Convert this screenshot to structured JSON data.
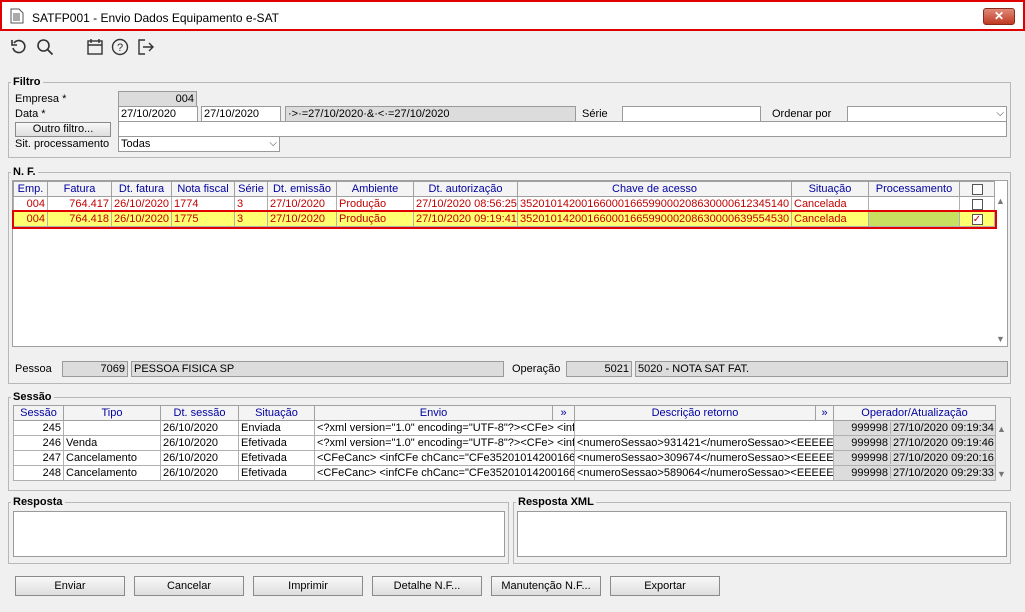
{
  "window": {
    "title": "SATFP001 - Envio Dados Equipamento e-SAT",
    "close": "✕"
  },
  "toolbar": {
    "icons": [
      "refresh-icon",
      "search-icon",
      "calendar-icon",
      "help-icon",
      "exit-icon"
    ]
  },
  "filtro": {
    "legend": "Filtro",
    "empresa_label": "Empresa *",
    "empresa_value": "004",
    "data_label": "Data *",
    "data_from": "27/10/2020",
    "data_to": "27/10/2020",
    "data_expr": "·>·=27/10/2020·&·<·=27/10/2020",
    "serie_label": "Série",
    "serie_value": "",
    "ordenar_label": "Ordenar por",
    "ordenar_value": "",
    "outro_filtro": "Outro filtro...",
    "outro_value": "",
    "sit_label": "Sit. processamento",
    "sit_value": "Todas"
  },
  "nf": {
    "legend": "N. F.",
    "columns": [
      "Emp.",
      "Fatura",
      "Dt. fatura",
      "Nota fiscal",
      "Série",
      "Dt. emissão",
      "Ambiente",
      "Dt. autorização",
      "Chave de acesso",
      "Situação",
      "Processamento"
    ],
    "rows": [
      {
        "emp": "004",
        "fatura": "764.417",
        "dt_fatura": "26/10/2020",
        "nota": "1774",
        "serie": "3",
        "dt_emissao": "27/10/2020",
        "ambiente": "Produção",
        "dt_aut": "27/10/2020 08:56:25",
        "chave": "35201014200166000166599000208630000612345140",
        "situacao": "Cancelada",
        "proc": "",
        "checked": false
      },
      {
        "emp": "004",
        "fatura": "764.418",
        "dt_fatura": "26/10/2020",
        "nota": "1775",
        "serie": "3",
        "dt_emissao": "27/10/2020",
        "ambiente": "Produção",
        "dt_aut": "27/10/2020 09:19:41",
        "chave": "35201014200166000166599000208630000639554530",
        "situacao": "Cancelada",
        "proc": "",
        "checked": true
      }
    ],
    "pessoa_label": "Pessoa",
    "pessoa_code": "7069",
    "pessoa_name": "PESSOA FISICA SP",
    "operacao_label": "Operação",
    "operacao_code": "5021",
    "operacao_name": "5020 - NOTA SAT FAT."
  },
  "sessao": {
    "legend": "Sessão",
    "columns": [
      "Sessão",
      "Tipo",
      "Dt. sessão",
      "Situação",
      "Envio",
      "»",
      "Descrição retorno",
      "»",
      "Operador/Atualização"
    ],
    "rows": [
      {
        "sessao": "245",
        "tipo": "",
        "dt": "26/10/2020",
        "sit": "Enviada",
        "envio": "<?xml version=\"1.0\" encoding=\"UTF-8\"?><CFe> <infC",
        "desc": "",
        "op": "999998",
        "atual": "27/10/2020 09:19:34"
      },
      {
        "sessao": "246",
        "tipo": "Venda",
        "dt": "26/10/2020",
        "sit": "Efetivada",
        "envio": "<?xml version=\"1.0\" encoding=\"UTF-8\"?><CFe> <infC",
        "desc": "<numeroSessao>931421</numeroSessao><EEEEE>0",
        "op": "999998",
        "atual": "27/10/2020 09:19:46"
      },
      {
        "sessao": "247",
        "tipo": "Cancelamento",
        "dt": "26/10/2020",
        "sit": "Efetivada",
        "envio": "<CFeCanc> <infCFe chCanc=\"CFe352010142001660",
        "desc": "<numeroSessao>309674</numeroSessao><EEEEE>0",
        "op": "999998",
        "atual": "27/10/2020 09:20:16"
      },
      {
        "sessao": "248",
        "tipo": "Cancelamento",
        "dt": "26/10/2020",
        "sit": "Efetivada",
        "envio": "<CFeCanc> <infCFe chCanc=\"CFe352010142001660",
        "desc": "<numeroSessao>589064</numeroSessao><EEEEE>0",
        "op": "999998",
        "atual": "27/10/2020 09:29:33"
      }
    ]
  },
  "resposta": {
    "legend": "Resposta",
    "value": ""
  },
  "resposta_xml": {
    "legend": "Resposta XML",
    "value": ""
  },
  "buttons": {
    "enviar": "Enviar",
    "cancelar": "Cancelar",
    "imprimir": "Imprimir",
    "detalhe": "Detalhe N.F...",
    "manutencao": "Manutenção N.F...",
    "exportar": "Exportar"
  }
}
